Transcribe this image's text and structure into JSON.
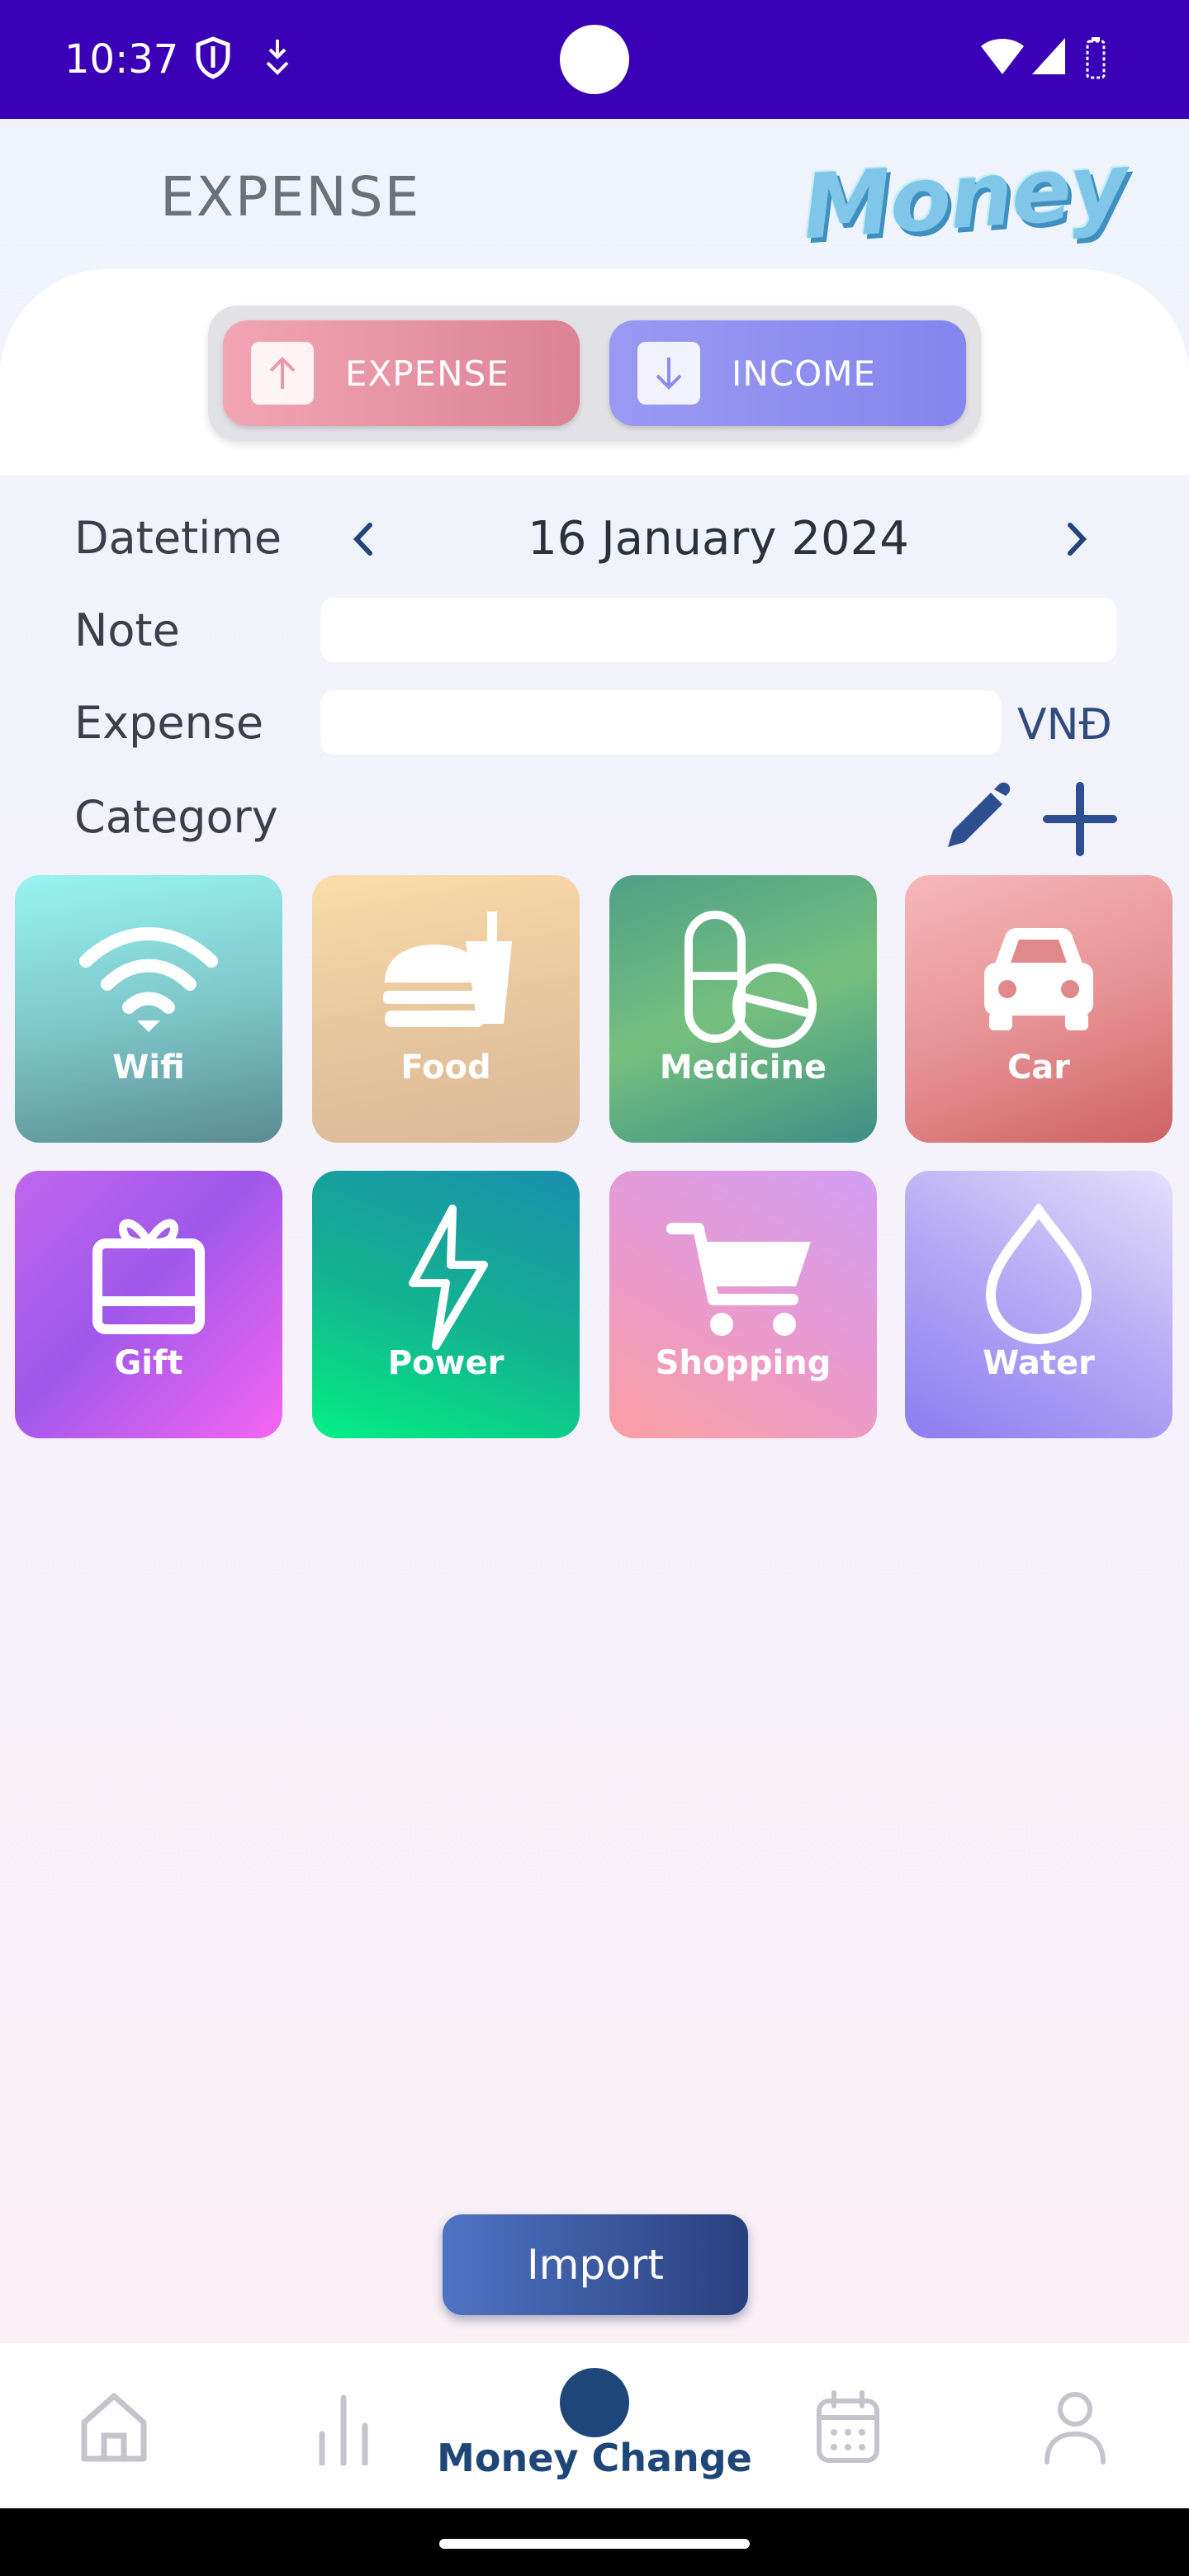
{
  "status_bar": {
    "time": "10:37",
    "icons": [
      "shield-icon",
      "download-icon",
      "wifi-icon",
      "signal-icon",
      "battery-icon"
    ]
  },
  "header": {
    "title": "EXPENSE",
    "logo_text": "Money"
  },
  "type_toggle": {
    "expense_label": "EXPENSE",
    "income_label": "INCOME"
  },
  "form": {
    "datetime_label": "Datetime",
    "date_value": "16 January 2024",
    "note_label": "Note",
    "note_value": "",
    "note_placeholder": "",
    "amount_label": "Expense",
    "amount_value": "",
    "amount_placeholder": "",
    "currency": "VNĐ",
    "category_label": "Category"
  },
  "categories": [
    {
      "name": "Wifi",
      "icon": "wifi-icon"
    },
    {
      "name": "Food",
      "icon": "burger-drink-icon"
    },
    {
      "name": "Medicine",
      "icon": "pill-icon"
    },
    {
      "name": "Car",
      "icon": "car-icon"
    },
    {
      "name": "Gift",
      "icon": "gift-icon"
    },
    {
      "name": "Power",
      "icon": "lightning-icon"
    },
    {
      "name": "Shopping",
      "icon": "cart-icon"
    },
    {
      "name": "Water",
      "icon": "drop-icon"
    }
  ],
  "import_button": "Import",
  "bottom_nav": {
    "active_label": "Money Change",
    "items": [
      "home-icon",
      "chart-icon",
      "money-change-icon",
      "calendar-icon",
      "profile-icon"
    ]
  },
  "colors": {
    "status_bar": "#3a00b5",
    "accent_navy": "#1f4679",
    "expense_pink": "#dc8396",
    "income_purple": "#8585ee"
  }
}
